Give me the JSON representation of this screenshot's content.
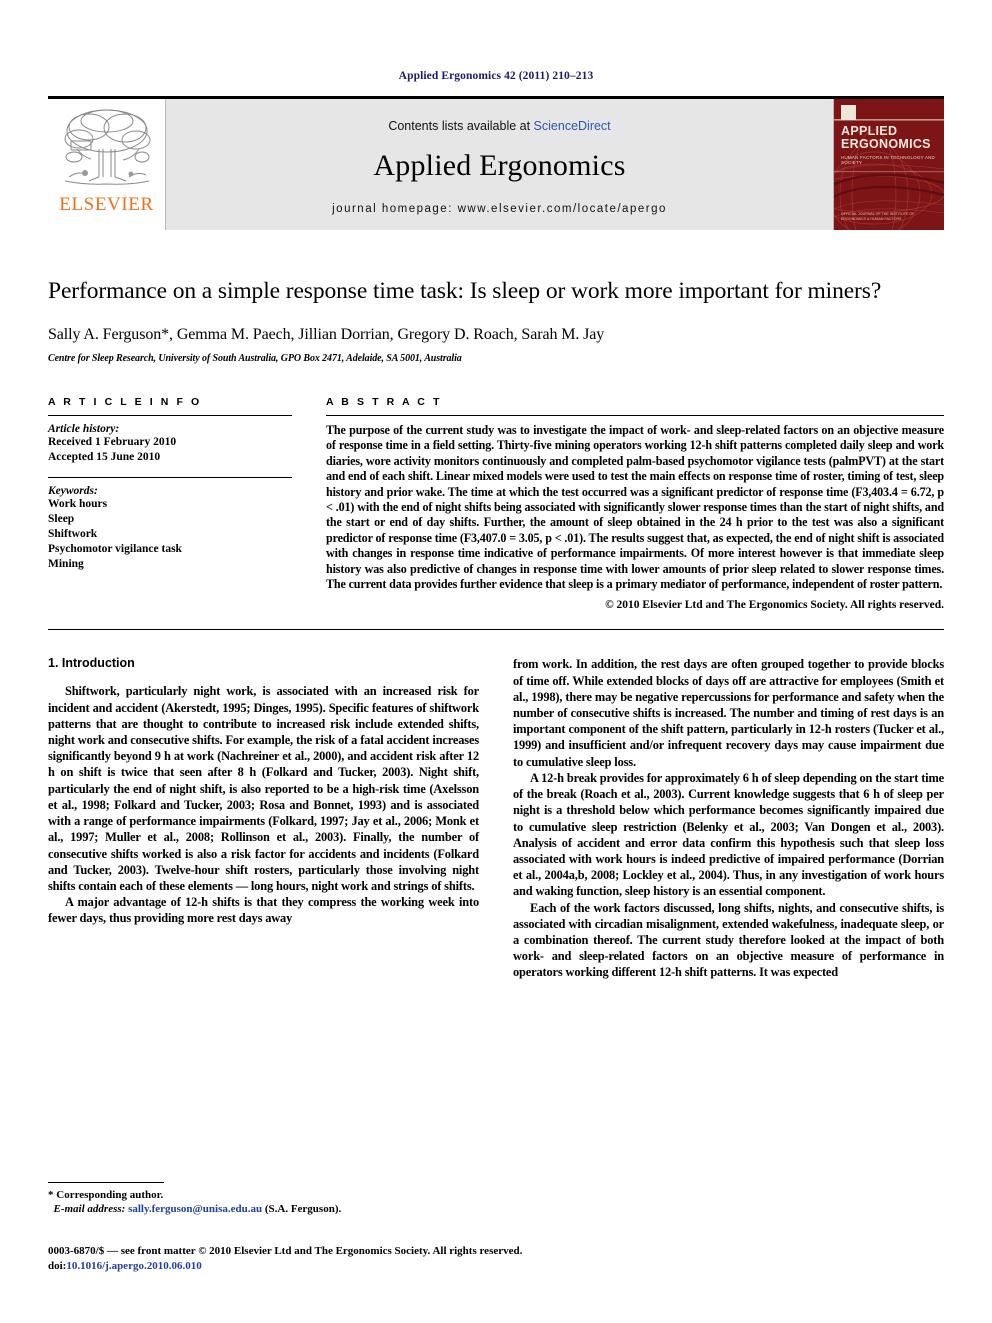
{
  "running_head": "Applied Ergonomics 42 (2011) 210–213",
  "masthead": {
    "publisher_name": "ELSEVIER",
    "contents_prefix": "Contents lists available at ",
    "contents_link": "ScienceDirect",
    "journal_title": "Applied Ergonomics",
    "homepage": "journal homepage: www.elsevier.com/locate/apergo",
    "cover": {
      "title": "APPLIED ERGONOMICS",
      "subtitle": "HUMAN FACTORS IN TECHNOLOGY AND SOCIETY",
      "footer": "OFFICIAL JOURNAL OF THE\nINSTITUTE OF ERGONOMICS & HUMAN FACTORS"
    }
  },
  "article": {
    "title": "Performance on a simple response time task: Is sleep or work more important for miners?",
    "authors": "Sally A. Ferguson*, Gemma M. Paech, Jillian Dorrian, Gregory D. Roach, Sarah M. Jay",
    "affiliation": "Centre for Sleep Research, University of South Australia, GPO Box 2471, Adelaide, SA 5001, Australia"
  },
  "article_info": {
    "heading": "A R T I C L E  I N F O",
    "history_label": "Article history:",
    "received": "Received 1 February 2010",
    "accepted": "Accepted 15 June 2010",
    "keywords_label": "Keywords:",
    "keywords": [
      "Work hours",
      "Sleep",
      "Shiftwork",
      "Psychomotor vigilance task",
      "Mining"
    ]
  },
  "abstract": {
    "heading": "A B S T R A C T",
    "text": "The purpose of the current study was to investigate the impact of work- and sleep-related factors on an objective measure of response time in a field setting. Thirty-five mining operators working 12-h shift patterns completed daily sleep and work diaries, wore activity monitors continuously and completed palm-based psychomotor vigilance tests (palmPVT) at the start and end of each shift. Linear mixed models were used to test the main effects on response time of roster, timing of test, sleep history and prior wake. The time at which the test occurred was a significant predictor of response time (F3,403.4 = 6.72, p < .01) with the end of night shifts being associated with significantly slower response times than the start of night shifts, and the start or end of day shifts. Further, the amount of sleep obtained in the 24 h prior to the test was also a significant predictor of response time (F3,407.0 = 3.05, p < .01). The results suggest that, as expected, the end of night shift is associated with changes in response time indicative of performance impairments. Of more interest however is that immediate sleep history was also predictive of changes in response time with lower amounts of prior sleep related to slower response times. The current data provides further evidence that sleep is a primary mediator of performance, independent of roster pattern.",
    "copyright": "© 2010 Elsevier Ltd and The Ergonomics Society. All rights reserved."
  },
  "body": {
    "section_number_title": "1.  Introduction",
    "left_paragraphs": [
      "Shiftwork, particularly night work, is associated with an increased risk for incident and accident (Akerstedt, 1995; Dinges, 1995). Specific features of shiftwork patterns that are thought to contribute to increased risk include extended shifts, night work and consecutive shifts. For example, the risk of a fatal accident increases significantly beyond 9 h at work (Nachreiner et al., 2000), and accident risk after 12 h on shift is twice that seen after 8 h (Folkard and Tucker, 2003). Night shift, particularly the end of night shift, is also reported to be a high-risk time (Axelsson et al., 1998; Folkard and Tucker, 2003; Rosa and Bonnet, 1993) and is associated with a range of performance impairments (Folkard, 1997; Jay et al., 2006; Monk et al., 1997; Muller et al., 2008; Rollinson et al., 2003). Finally, the number of consecutive shifts worked is also a risk factor for accidents and incidents (Folkard and Tucker, 2003). Twelve-hour shift rosters, particularly those involving night shifts contain each of these elements — long hours, night work and strings of shifts.",
      "A major advantage of 12-h shifts is that they compress the working week into fewer days, thus providing more rest days away"
    ],
    "right_paragraphs": [
      "from work. In addition, the rest days are often grouped together to provide blocks of time off. While extended blocks of days off are attractive for employees (Smith et al., 1998), there may be negative repercussions for performance and safety when the number of consecutive shifts is increased. The number and timing of rest days is an important component of the shift pattern, particularly in 12-h rosters (Tucker et al., 1999) and insufficient and/or infrequent recovery days may cause impairment due to cumulative sleep loss.",
      "A 12-h break provides for approximately 6 h of sleep depending on the start time of the break (Roach et al., 2003). Current knowledge suggests that 6 h of sleep per night is a threshold below which performance becomes significantly impaired due to cumulative sleep restriction (Belenky et al., 2003; Van Dongen et al., 2003). Analysis of accident and error data confirm this hypothesis such that sleep loss associated with work hours is indeed predictive of impaired performance (Dorrian et al., 2004a,b, 2008; Lockley et al., 2004). Thus, in any investigation of work hours and waking function, sleep history is an essential component.",
      "Each of the work factors discussed, long shifts, nights, and consecutive shifts, is associated with circadian misalignment, extended wakefulness, inadequate sleep, or a combination thereof. The current study therefore looked at the impact of both work- and sleep-related factors on an objective measure of performance in operators working different 12-h shift patterns. It was expected"
    ]
  },
  "footnote": {
    "corresponding": "* Corresponding author.",
    "email_label": "E-mail address:",
    "email": "sally.ferguson@unisa.edu.au",
    "email_suffix": " (S.A. Ferguson)."
  },
  "footer": {
    "issn_line": "0003-6870/$ — see front matter © 2010 Elsevier Ltd and The Ergonomics Society. All rights reserved.",
    "doi_label": "doi:",
    "doi": "10.1016/j.apergo.2010.06.010"
  }
}
